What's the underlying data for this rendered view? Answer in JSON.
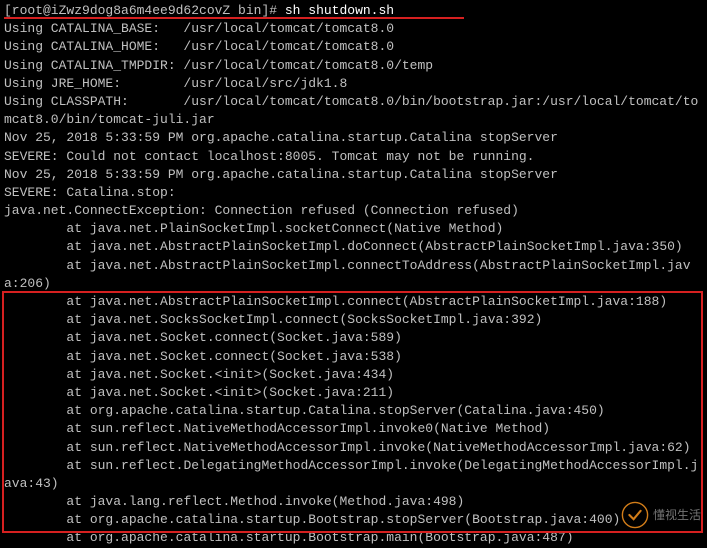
{
  "prompt": "[root@iZwz9dog8a6m4ee9d62covZ bin]#",
  "command": "sh shutdown.sh",
  "lines": [
    "Using CATALINA_BASE:   /usr/local/tomcat/tomcat8.0",
    "Using CATALINA_HOME:   /usr/local/tomcat/tomcat8.0",
    "Using CATALINA_TMPDIR: /usr/local/tomcat/tomcat8.0/temp",
    "Using JRE_HOME:        /usr/local/src/jdk1.8",
    "Using CLASSPATH:       /usr/local/tomcat/tomcat8.0/bin/bootstrap.jar:/usr/local/tomcat/tomcat8.0/bin/tomcat-juli.jar",
    "Nov 25, 2018 5:33:59 PM org.apache.catalina.startup.Catalina stopServer",
    "SEVERE: Could not contact localhost:8005. Tomcat may not be running.",
    "Nov 25, 2018 5:33:59 PM org.apache.catalina.startup.Catalina stopServer",
    "SEVERE: Catalina.stop:",
    "java.net.ConnectException: Connection refused (Connection refused)",
    "        at java.net.PlainSocketImpl.socketConnect(Native Method)",
    "        at java.net.AbstractPlainSocketImpl.doConnect(AbstractPlainSocketImpl.java:350)",
    "        at java.net.AbstractPlainSocketImpl.connectToAddress(AbstractPlainSocketImpl.java:206)",
    "        at java.net.AbstractPlainSocketImpl.connect(AbstractPlainSocketImpl.java:188)",
    "        at java.net.SocksSocketImpl.connect(SocksSocketImpl.java:392)",
    "        at java.net.Socket.connect(Socket.java:589)",
    "        at java.net.Socket.connect(Socket.java:538)",
    "        at java.net.Socket.<init>(Socket.java:434)",
    "        at java.net.Socket.<init>(Socket.java:211)",
    "        at org.apache.catalina.startup.Catalina.stopServer(Catalina.java:450)",
    "        at sun.reflect.NativeMethodAccessorImpl.invoke0(Native Method)",
    "        at sun.reflect.NativeMethodAccessorImpl.invoke(NativeMethodAccessorImpl.java:62)",
    "        at sun.reflect.DelegatingMethodAccessorImpl.invoke(DelegatingMethodAccessorImpl.java:43)",
    "        at java.lang.reflect.Method.invoke(Method.java:498)",
    "        at org.apache.catalina.startup.Bootstrap.stopServer(Bootstrap.java:400)",
    "        at org.apache.catalina.startup.Bootstrap.main(Bootstrap.java:487)"
  ],
  "watermark_text": "懂视生活",
  "annotations": {
    "underline_color": "#d62020",
    "box_color": "#d62020"
  }
}
